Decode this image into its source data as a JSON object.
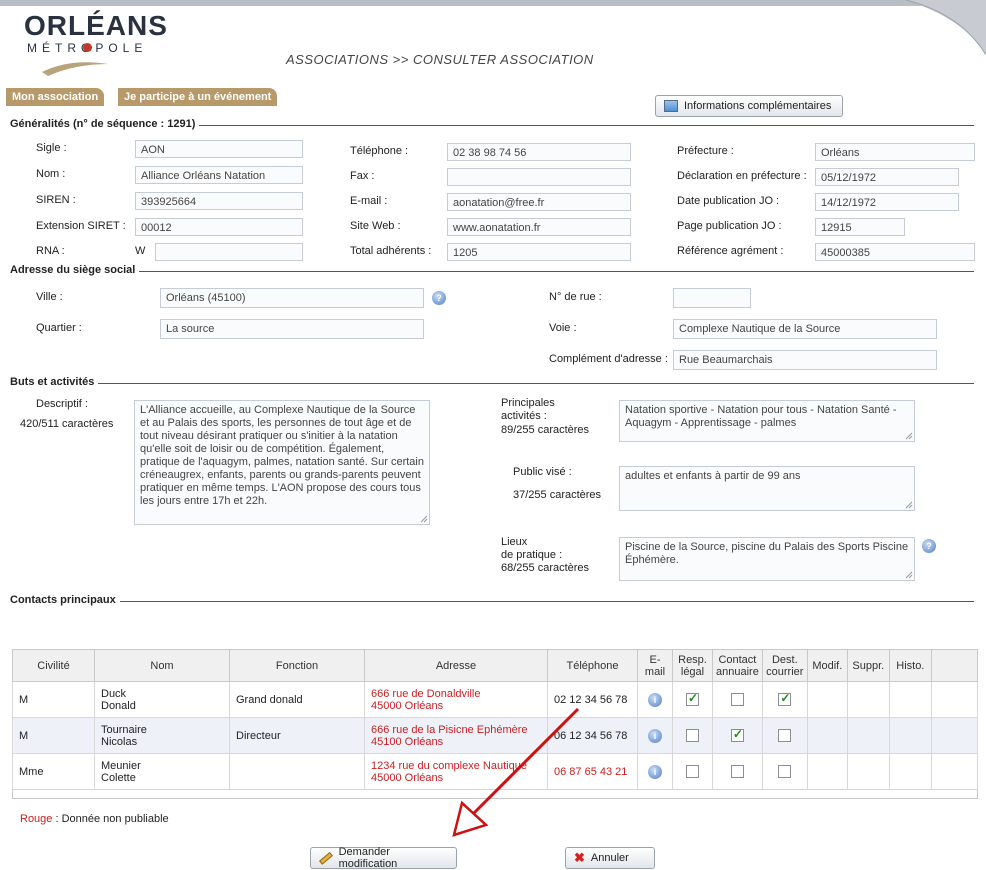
{
  "header": {
    "logo_main": "ORLÉANS",
    "logo_sub": "MÉTROPOLE",
    "page_title": "ASSOCIATIONS >> CONSULTER ASSOCIATION",
    "tabs": [
      {
        "label": "Mon association"
      },
      {
        "label": "Je participe à un événement"
      }
    ],
    "info_button": "Informations complémentaires"
  },
  "generalites": {
    "title": "Généralités (n° de séquence : 1291)",
    "sigle": {
      "label": "Sigle :",
      "value": "AON"
    },
    "nom": {
      "label": "Nom :",
      "value": "Alliance Orléans Natation"
    },
    "siren": {
      "label": "SIREN :",
      "value": "393925664"
    },
    "siret": {
      "label": "Extension SIRET :",
      "value": "00012"
    },
    "rna": {
      "label": "RNA :",
      "prefix": "W",
      "value": ""
    },
    "telephone": {
      "label": "Téléphone :",
      "value": "02 38 98 74 56"
    },
    "fax": {
      "label": "Fax :",
      "value": ""
    },
    "email": {
      "label": "E-mail :",
      "value": "aonatation@free.fr"
    },
    "site": {
      "label": "Site Web :",
      "value": "www.aonatation.fr"
    },
    "adherents": {
      "label": "Total adhérents :",
      "value": "1205"
    },
    "prefecture": {
      "label": "Préfecture :",
      "value": "Orléans"
    },
    "declaration": {
      "label": "Déclaration en préfecture :",
      "value": "05/12/1972"
    },
    "date_jo": {
      "label": "Date publication JO :",
      "value": "14/12/1972"
    },
    "page_jo": {
      "label": "Page publication JO :",
      "value": "12915"
    },
    "agrement": {
      "label": "Référence agrément :",
      "value": "45000385"
    }
  },
  "adresse": {
    "title": "Adresse du siège social",
    "ville": {
      "label": "Ville :",
      "value": "Orléans (45100)"
    },
    "quartier": {
      "label": "Quartier :",
      "value": "La source"
    },
    "num_rue": {
      "label": "N° de rue :",
      "value": ""
    },
    "voie": {
      "label": "Voie :",
      "value": "Complexe Nautique de la Source"
    },
    "complement": {
      "label": "Complément d'adresse :",
      "value": "Rue Beaumarchais"
    }
  },
  "buts": {
    "title": "Buts et activités",
    "descriptif": {
      "label": "Descriptif :",
      "count": "420/511 caractères",
      "value": "L'Alliance accueille, au Complexe Nautique de la Source et au Palais des sports, les personnes de tout âge et de tout niveau désirant pratiquer ou s'initier à la natation qu'elle soit de loisir ou de compétition. Également, pratique de l'aquagym, palmes, natation santé. Sur certain créneaugrex, enfants, parents ou grands-parents peuvent pratiquer en même temps. L'AON propose des cours tous les jours entre 17h et 22h."
    },
    "activites": {
      "label_l1": "Principales",
      "label_l2": "activités :",
      "count": "89/255 caractères",
      "value": "Natation sportive - Natation pour tous - Natation Santé -Aquagym - Apprentissage - palmes"
    },
    "public": {
      "label": "Public visé :",
      "count": "37/255 caractères",
      "value": "adultes et enfants à partir de 99 ans"
    },
    "lieux": {
      "label_l1": "Lieux",
      "label_l2": "de pratique :",
      "count": "68/255 caractères",
      "value": "Piscine de la Source, piscine du Palais des Sports Piscine Éphémère."
    }
  },
  "contacts": {
    "title": "Contacts principaux",
    "columns": [
      "Civilité",
      "Nom",
      "Fonction",
      "Adresse",
      "Téléphone",
      "E-mail",
      "Resp. légal",
      "Contact annuaire",
      "Dest. courrier",
      "Modif.",
      "Suppr.",
      "Histo."
    ],
    "rows": [
      {
        "civilite": "M",
        "nom1": "Duck",
        "nom2": "Donald",
        "fonction": "Grand donald",
        "adr1": "666 rue de Donaldville",
        "adr2": "45000 Orléans",
        "tel": "02 12 34 56 78",
        "resp": true,
        "annuaire": false,
        "courrier": true
      },
      {
        "civilite": "M",
        "nom1": "Tournaire",
        "nom2": "Nicolas",
        "fonction": "Directeur",
        "adr1": "666 rue de la Pisicne Ephémère",
        "adr2": "45100 Orléans",
        "tel": "06 12 34 56 78",
        "resp": false,
        "annuaire": true,
        "courrier": false
      },
      {
        "civilite": "Mme",
        "nom1": "Meunier",
        "nom2": "Colette",
        "fonction": "",
        "adr1": "1234 rue du complexe Nautique",
        "adr2": "45000 Orléans",
        "tel": "06 87 65 43 21",
        "resp": false,
        "annuaire": false,
        "courrier": false
      }
    ]
  },
  "footer": {
    "legend_red": "Rouge",
    "legend_text": " : Donnée non publiable",
    "request_button": "Demander modification",
    "cancel_button": "Annuler"
  },
  "colors": {
    "accent_red": "#cc1f1f",
    "tab_brown": "#b89a6a",
    "annotation_arrow": "#d01010"
  }
}
